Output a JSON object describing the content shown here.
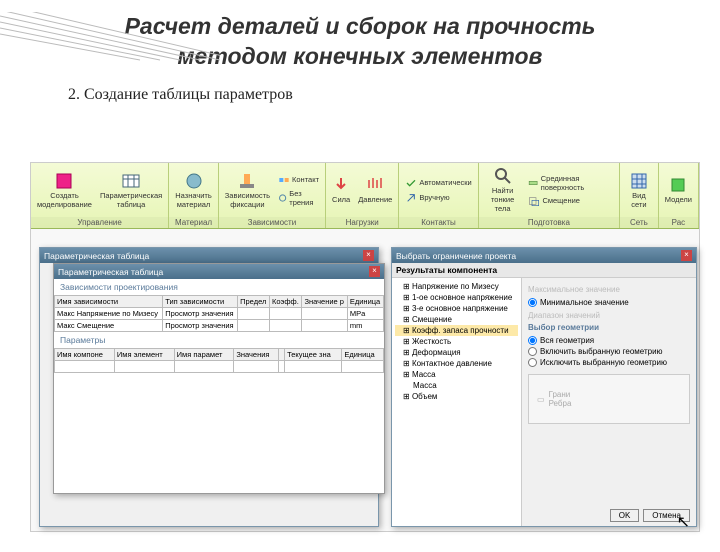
{
  "slide": {
    "title_line1": "Расчет деталей и сборок на прочность",
    "title_line2": "методом конечных элементов",
    "subtitle": "2. Создание таблицы параметров"
  },
  "ribbon": {
    "groups": [
      {
        "label": "Управление",
        "items": [
          {
            "label": "Создать\nмоделирование",
            "icon": "cube"
          },
          {
            "label": "Параметрическая\nтаблица",
            "icon": "table"
          }
        ]
      },
      {
        "label": "Материал",
        "items": [
          {
            "label": "Назначить\nматериал",
            "icon": "material"
          }
        ]
      },
      {
        "label": "Зависимости",
        "items": [
          {
            "label": "Зависимость\nфиксации",
            "icon": "fix"
          },
          {
            "label": "Контакт",
            "icon": "contact",
            "small": true
          },
          {
            "label": "Без трения",
            "icon": "friction",
            "small": true
          }
        ]
      },
      {
        "label": "Нагрузки",
        "items": [
          {
            "label": "Сила",
            "icon": "force"
          },
          {
            "label": "Давление",
            "icon": "pressure"
          }
        ]
      },
      {
        "label": "Контакты",
        "items": [
          {
            "label": "Автоматически",
            "icon": "auto",
            "small": true
          },
          {
            "label": "Вручную",
            "icon": "manual",
            "small": true
          }
        ]
      },
      {
        "label": "Подготовка",
        "items": [
          {
            "label": "Найти\nтонкие тела",
            "icon": "find"
          },
          {
            "label": "Срединная поверхность",
            "icon": "mid",
            "small": true
          },
          {
            "label": "Смещение",
            "icon": "offset",
            "small": true
          }
        ]
      },
      {
        "label": "Сеть",
        "items": [
          {
            "label": "Вид сети",
            "icon": "mesh"
          }
        ]
      },
      {
        "label": "Рас",
        "items": [
          {
            "label": "Модели",
            "icon": "run"
          }
        ]
      }
    ]
  },
  "param_panel": {
    "outer_title": "Параметрическая таблица",
    "inner_title": "Параметрическая таблица",
    "section1": "Зависимости проектирования",
    "section2": "Параметры",
    "table1": {
      "headers": [
        "Имя зависимости",
        "Тип зависимости",
        "Предел",
        "Коэфф.",
        "Значение р",
        "Единица"
      ],
      "rows": [
        [
          "Макс Напряжение по Мизесу",
          "Просмотр значения",
          "",
          "",
          "",
          "MPa"
        ],
        [
          "Макс Смещение",
          "Просмотр значения",
          "",
          "",
          "",
          "mm"
        ]
      ]
    },
    "table2": {
      "headers": [
        "Имя компоне",
        "Имя элемент",
        "Имя парамет",
        "Значения",
        "",
        "Текущее зна",
        "Единица"
      ],
      "rows": [
        [
          "",
          "",
          "",
          "",
          "",
          "",
          ""
        ]
      ]
    }
  },
  "right_panel": {
    "title": "Выбрать ограничение проекта",
    "tree_header": "Результаты компонента",
    "tree": [
      {
        "label": "Напряжение по Мизесу"
      },
      {
        "label": "1-ое основное напряжение"
      },
      {
        "label": "3-е основное напряжение"
      },
      {
        "label": "Смещение"
      },
      {
        "label": "Коэфф. запаса прочности",
        "selected": true
      },
      {
        "label": "Жесткость"
      },
      {
        "label": "Деформация"
      },
      {
        "label": "Контактное давление"
      },
      {
        "label": "Масса"
      },
      {
        "label": "Масса",
        "sub": true
      },
      {
        "label": "Объем"
      }
    ],
    "form": {
      "group1_title": "Максимальное значение",
      "opt_min": "Минимальное значение",
      "group2_title": "Диапазон значений",
      "group3_title": "Выбор геометрии",
      "opt_all": "Вся геометрия",
      "opt_include": "Включить выбранную геометрию",
      "opt_exclude": "Исключить выбранную геометрию",
      "disabled_label": "Грани\nРебра"
    },
    "buttons": {
      "ok": "OK",
      "cancel": "Отмена"
    }
  }
}
